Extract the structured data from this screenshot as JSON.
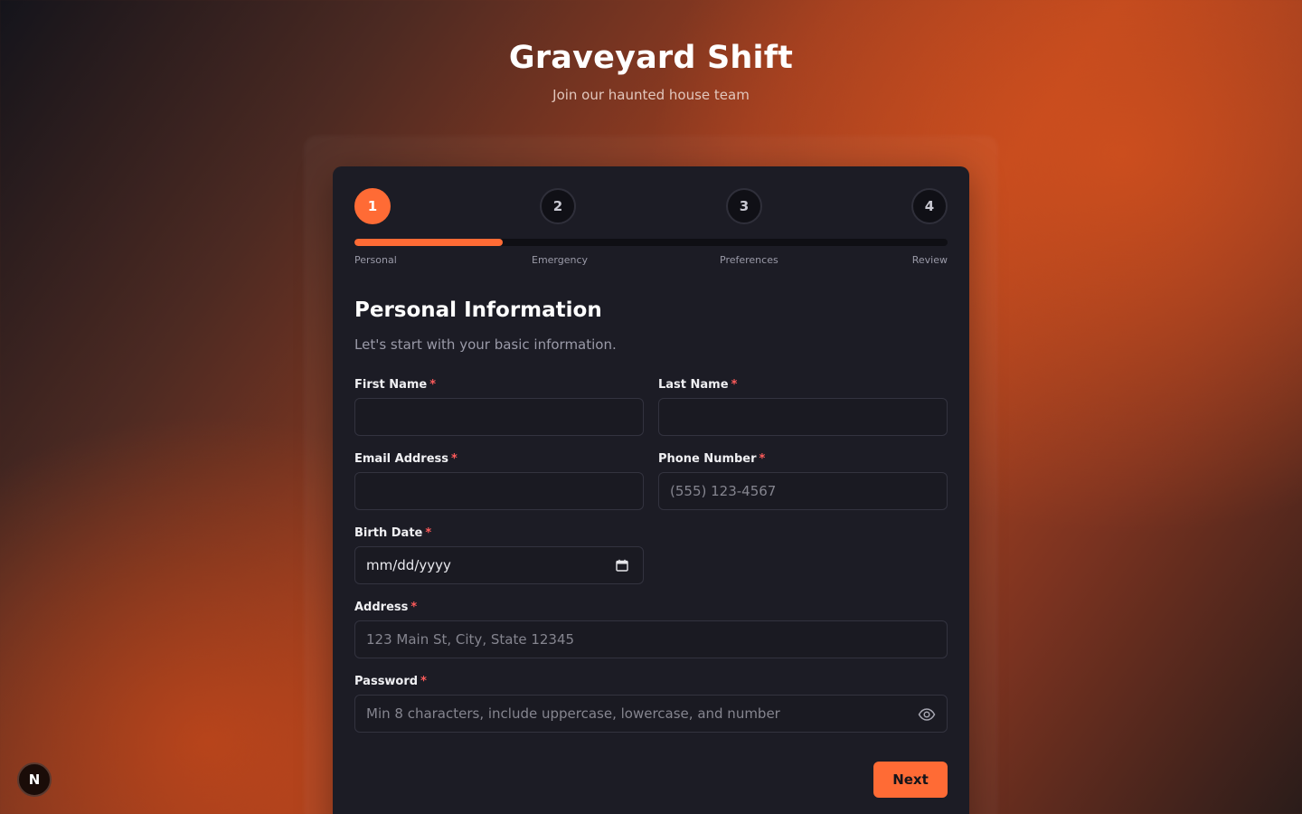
{
  "header": {
    "title": "Graveyard Shift",
    "subtitle": "Join our haunted house team"
  },
  "steps": [
    {
      "number": "1",
      "label": "Personal",
      "active": true
    },
    {
      "number": "2",
      "label": "Emergency",
      "active": false
    },
    {
      "number": "3",
      "label": "Preferences",
      "active": false
    },
    {
      "number": "4",
      "label": "Review",
      "active": false
    }
  ],
  "progress": {
    "fraction": 0.25,
    "color": "#ff6b35"
  },
  "section": {
    "title": "Personal Information",
    "description": "Let's start with your basic information."
  },
  "fields": {
    "first_name": {
      "label": "First Name",
      "required": "*",
      "placeholder": ""
    },
    "last_name": {
      "label": "Last Name",
      "required": "*",
      "placeholder": ""
    },
    "email": {
      "label": "Email Address",
      "required": "*",
      "placeholder": ""
    },
    "phone": {
      "label": "Phone Number",
      "required": "*",
      "placeholder": "(555) 123-4567"
    },
    "birth_date": {
      "label": "Birth Date",
      "required": "*",
      "value": "mm/dd/yyyy",
      "icon": "calendar-icon"
    },
    "address": {
      "label": "Address",
      "required": "*",
      "placeholder": "123 Main St, City, State 12345"
    },
    "password": {
      "label": "Password",
      "required": "*",
      "placeholder": "Min 8 characters, include uppercase, lowercase, and number",
      "icon": "eye-icon"
    }
  },
  "actions": {
    "next_label": "Next"
  },
  "badge": {
    "letter": "N"
  },
  "colors": {
    "accent": "#ff6b35",
    "required": "#ff5b5b",
    "card": "#1c1c25"
  }
}
